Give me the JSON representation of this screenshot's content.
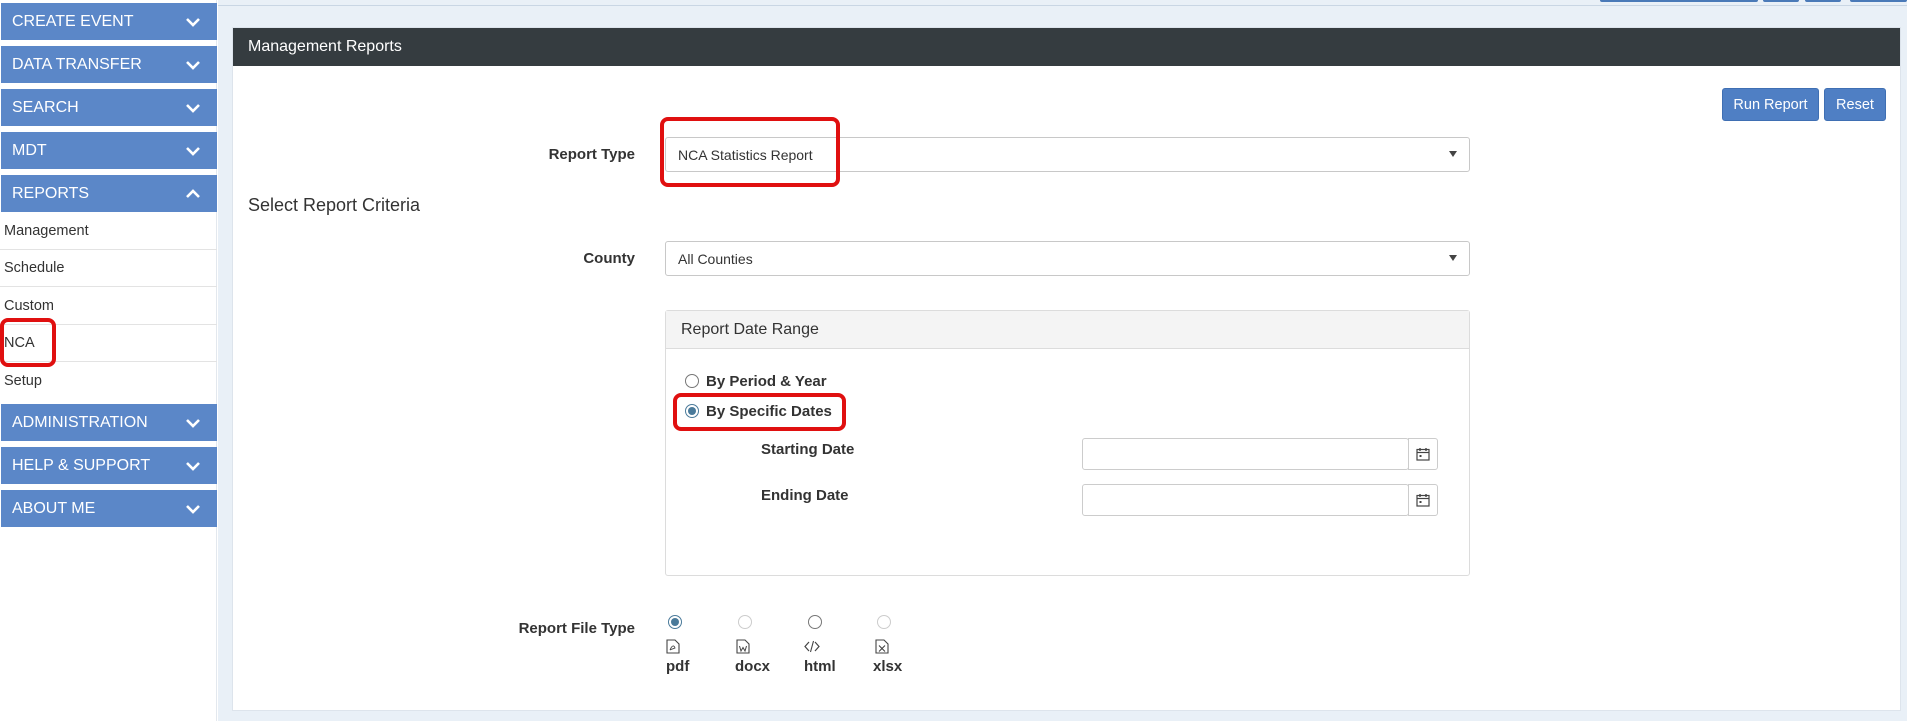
{
  "sidebar": {
    "sections": [
      {
        "label": "CREATE EVENT",
        "expanded": false
      },
      {
        "label": "DATA TRANSFER",
        "expanded": false
      },
      {
        "label": "SEARCH",
        "expanded": false
      },
      {
        "label": "MDT",
        "expanded": false
      },
      {
        "label": "REPORTS",
        "expanded": true
      },
      {
        "label": "ADMINISTRATION",
        "expanded": false
      },
      {
        "label": "HELP & SUPPORT",
        "expanded": false
      },
      {
        "label": "ABOUT ME",
        "expanded": false
      }
    ],
    "report_items": [
      "Management",
      "Schedule",
      "Custom",
      "NCA",
      "Setup"
    ]
  },
  "panel": {
    "title": "Management Reports",
    "run_report_label": "Run Report",
    "reset_label": "Reset"
  },
  "form": {
    "report_type_label": "Report Type",
    "report_type_value": "NCA Statistics Report",
    "criteria_title": "Select Report Criteria",
    "county_label": "County",
    "county_value": "All Counties",
    "date_range": {
      "title": "Report Date Range",
      "option_period": "By Period & Year",
      "option_specific": "By Specific Dates",
      "selected": "By Specific Dates",
      "starting_label": "Starting Date",
      "starting_value": "",
      "ending_label": "Ending Date",
      "ending_value": ""
    },
    "file_type_label": "Report File Type",
    "file_types": [
      {
        "label": "pdf",
        "icon": "pdf-icon",
        "selected": true,
        "enabled": true
      },
      {
        "label": "docx",
        "icon": "word-icon",
        "selected": false,
        "enabled": false
      },
      {
        "label": "html",
        "icon": "code-icon",
        "selected": false,
        "enabled": true
      },
      {
        "label": "xlsx",
        "icon": "excel-icon",
        "selected": false,
        "enabled": false
      }
    ]
  },
  "colors": {
    "nav_blue": "#5b87c8",
    "header_dark": "#353c40",
    "button_blue": "#4f7fc4",
    "highlight_red": "#e01010"
  }
}
